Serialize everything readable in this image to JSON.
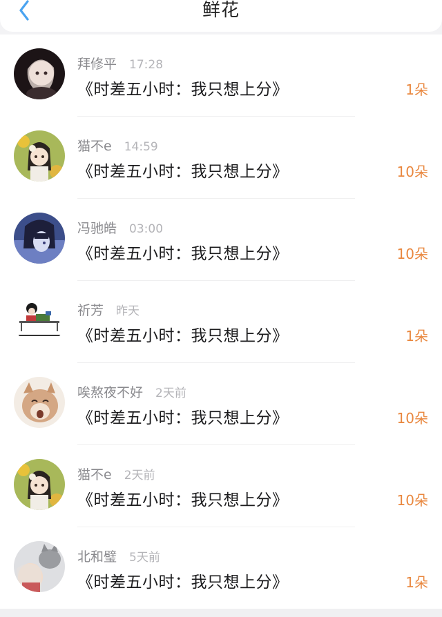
{
  "header": {
    "title": "鲜花",
    "back_icon": "chevron-left-icon"
  },
  "colors": {
    "accent_count": "#e9873e",
    "back_icon": "#4aa3f0",
    "name": "#8a8a8e",
    "time": "#b4b4b8"
  },
  "entries": [
    {
      "name": "拜修平",
      "time": "17:28",
      "book": "《时差五小时：我只想上分》",
      "count": "1朵",
      "avatar": "photo-dark-girl"
    },
    {
      "name": "猫不e",
      "time": "14:59",
      "book": "《时差五小时：我只想上分》",
      "count": "10朵",
      "avatar": "anime-girl-sunflower"
    },
    {
      "name": "冯驰皓",
      "time": "03:00",
      "book": "《时差五小时：我只想上分》",
      "count": "10朵",
      "avatar": "anime-boy-blue"
    },
    {
      "name": "祈芳",
      "time": "昨天",
      "book": "《时差五小时：我只想上分》",
      "count": "1朵",
      "avatar": "cartoon-desk-worker"
    },
    {
      "name": "唉熬夜不好",
      "time": "2天前",
      "book": "《时差五小时：我只想上分》",
      "count": "10朵",
      "avatar": "cartoon-cat-beige"
    },
    {
      "name": "猫不e",
      "time": "2天前",
      "book": "《时差五小时：我只想上分》",
      "count": "10朵",
      "avatar": "anime-girl-sunflower"
    },
    {
      "name": "北和璧",
      "time": "5天前",
      "book": "《时差五小时：我只想上分》",
      "count": "1朵",
      "avatar": "photo-cat-girl"
    }
  ]
}
